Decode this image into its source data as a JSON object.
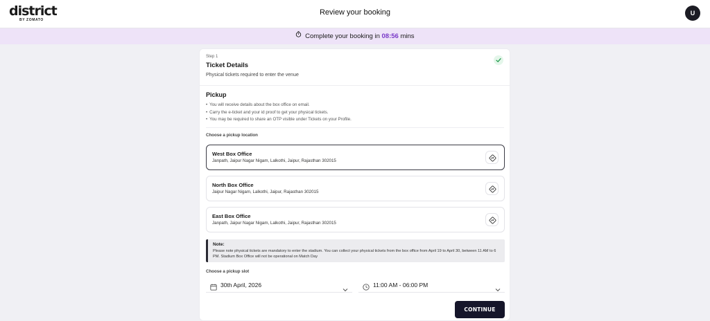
{
  "header": {
    "logo_main": "district",
    "logo_sub": "BY ZOMATO",
    "title": "Review your booking",
    "avatar_initial": "U"
  },
  "timer": {
    "prefix": "Complete your booking in",
    "time": "08:56",
    "suffix": "mins",
    "accent_color": "#7a3ac8"
  },
  "step": {
    "label": "Step 1",
    "title": "Ticket Details",
    "subtitle": "Physical tickets required to enter the venue",
    "status_icon": "check-icon"
  },
  "pickup": {
    "title": "Pickup",
    "bullets": [
      "You will receive details about the box office on email.",
      "Carry the e-ticket and your id proof to get your physical tickets.",
      "You may be required to share an OTP visible under Tickets on your Profile."
    ],
    "choose_location_label": "Choose a pickup location",
    "offices": [
      {
        "name": "West Box Office",
        "address": "Janpath, Jaipur Nagar Nigam, Lalkothi, Jaipur, Rajasthan 302015",
        "selected": true
      },
      {
        "name": "North Box Office",
        "address": "Jaipur Nagar Nigam, Lalkothi, Jaipur, Rajasthan 302015",
        "selected": false
      },
      {
        "name": "East Box Office",
        "address": "Janpath, Jaipur Nagar Nigam, Lalkothi, Jaipur, Rajasthan 302015",
        "selected": false
      }
    ]
  },
  "note": {
    "title": "Note:",
    "body": "Please note physical tickets are mandatory to enter the stadium. You can collect your physical tickets from the box office from April 19 to April 30, between 11 AM to 6 PM. Stadium Box Office will not be operational on Match Day"
  },
  "slot": {
    "label": "Choose a pickup slot",
    "date": "30th April, 2026",
    "time": "11:00 AM - 06:00 PM"
  },
  "actions": {
    "continue_label": "CONTINUE"
  }
}
